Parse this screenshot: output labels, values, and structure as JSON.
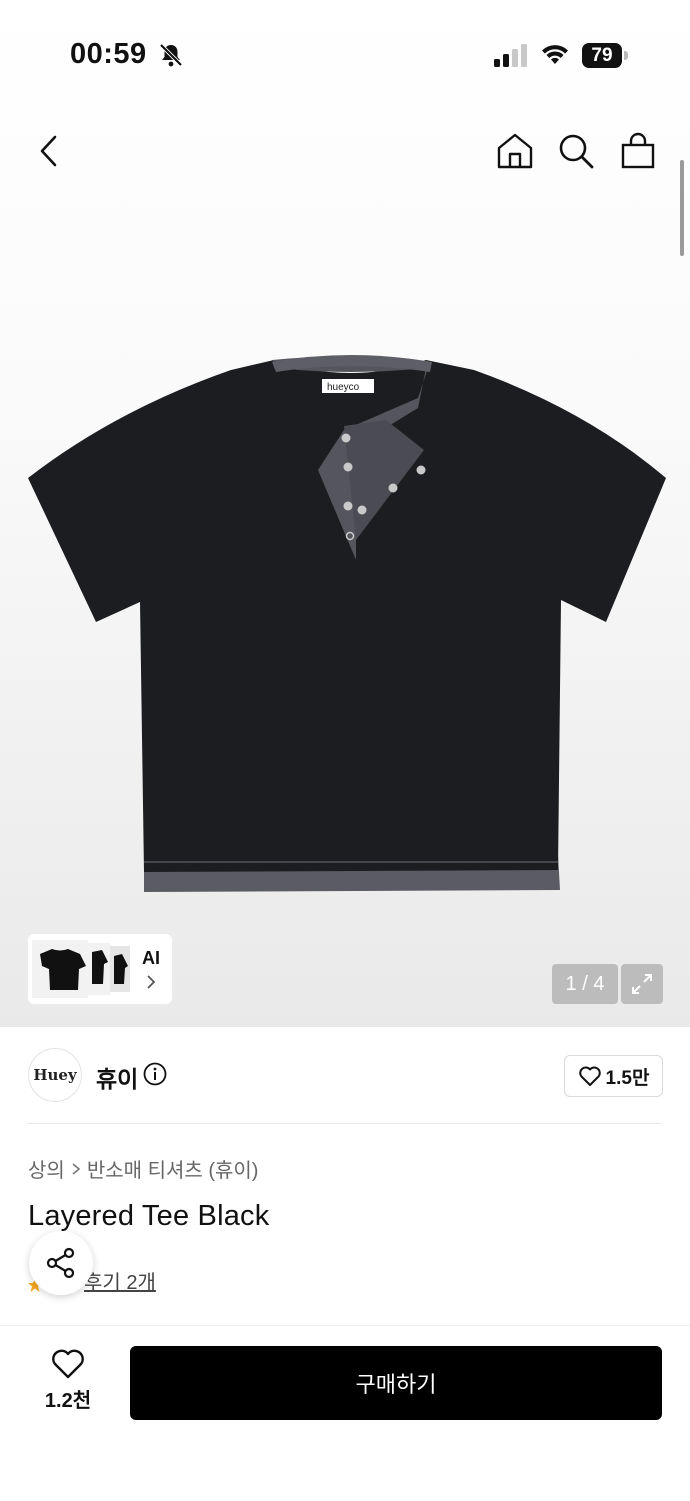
{
  "status_bar": {
    "time": "00:59",
    "battery": "79"
  },
  "gallery": {
    "thumb_label": "AI",
    "counter": "1 / 4",
    "tag_text": "hueyco"
  },
  "brand": {
    "logo_text": "Huey",
    "name": "휴이",
    "likes": "1.5만"
  },
  "breadcrumb": [
    "상의",
    "반소매 티셔츠 (휴이)"
  ],
  "product": {
    "title": "Layered Tee Black",
    "review_label": "후기 2개"
  },
  "bottom": {
    "wish_count": "1.2천",
    "buy_label": "구매하기"
  },
  "colors": {
    "accent": "#000000",
    "star": "#f5a623"
  },
  "icons": [
    "back-icon",
    "home-icon",
    "search-icon",
    "bag-icon",
    "expand-icon",
    "info-icon",
    "heart-icon",
    "share-icon",
    "star-icon"
  ]
}
